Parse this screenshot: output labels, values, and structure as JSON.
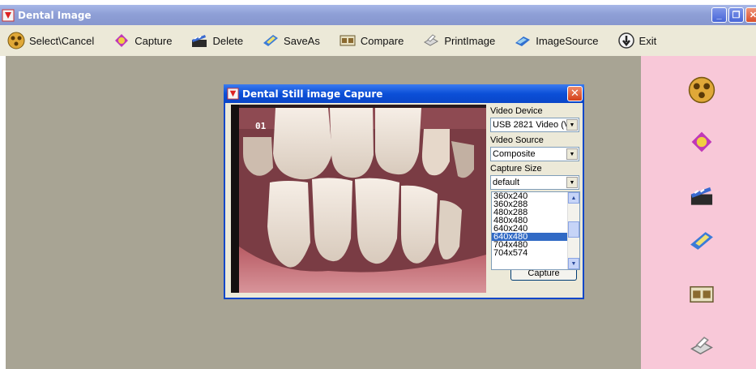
{
  "window": {
    "title": "Dental Image",
    "buttons": [
      "minimize",
      "restore",
      "close"
    ]
  },
  "toolbar": {
    "items": [
      {
        "label": "Select\\Cancel",
        "icon": "film-reel-icon"
      },
      {
        "label": "Capture",
        "icon": "capture-icon"
      },
      {
        "label": "Delete",
        "icon": "clapper-icon"
      },
      {
        "label": "SaveAs",
        "icon": "disk-icon"
      },
      {
        "label": "Compare",
        "icon": "compare-icon"
      },
      {
        "label": "PrintImage",
        "icon": "printer-icon"
      },
      {
        "label": "ImageSource",
        "icon": "source-icon"
      },
      {
        "label": "Exit",
        "icon": "exit-icon"
      }
    ]
  },
  "right_panel": {
    "icons": [
      "film-reel-icon",
      "capture-icon",
      "clapper-icon",
      "disk-icon",
      "compare-icon",
      "printer-icon"
    ]
  },
  "dialog": {
    "title": "Dental  Still image Capure",
    "video_overlay": "01",
    "video_device": {
      "label": "Video Device",
      "value": "USB 2821 Video (V"
    },
    "video_source": {
      "label": "Video Source",
      "value": "Composite"
    },
    "capture_size": {
      "label": "Capture Size",
      "value": "default",
      "options": [
        "360x240",
        "360x288",
        "480x288",
        "480x480",
        "640x240",
        "640x480",
        "704x480",
        "704x574"
      ],
      "selected": "640x480"
    },
    "capture_button": "Capture"
  },
  "colors": {
    "titlebar": "#8e9fd6",
    "dialog_title": "#0b4fd8",
    "workspace": "#a8a494",
    "right_panel": "#f8c8d8",
    "selection": "#316ac5"
  }
}
